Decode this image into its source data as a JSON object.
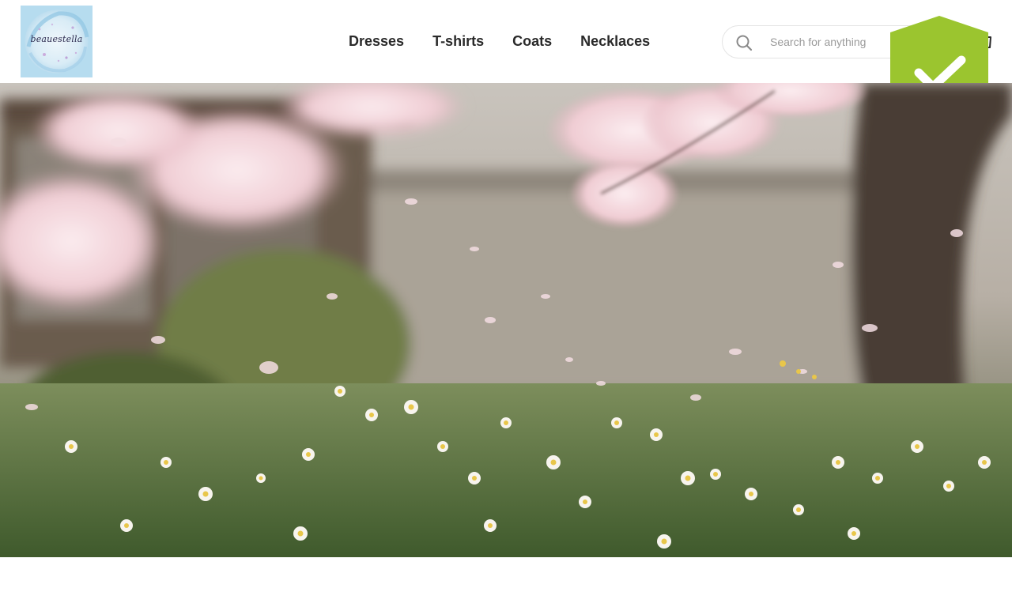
{
  "brand": {
    "logo_text": "beauestella",
    "logo_icon": "brand-logo"
  },
  "nav": {
    "items": [
      {
        "label": "Dresses"
      },
      {
        "label": "T-shirts"
      },
      {
        "label": "Coats"
      },
      {
        "label": "Necklaces"
      }
    ]
  },
  "search": {
    "placeholder": "Search for anything",
    "value": "",
    "icon": "search-icon"
  },
  "cart": {
    "icon": "shopping-bag-icon"
  },
  "security_badge": {
    "icon": "shield-check-icon",
    "color": "#9bc52f"
  },
  "hero": {
    "image": "cherry-blossom-garden-image"
  },
  "colors": {
    "text": "#2a2a2a",
    "border": "#e4e4e4",
    "badge_green": "#9bc52f"
  }
}
